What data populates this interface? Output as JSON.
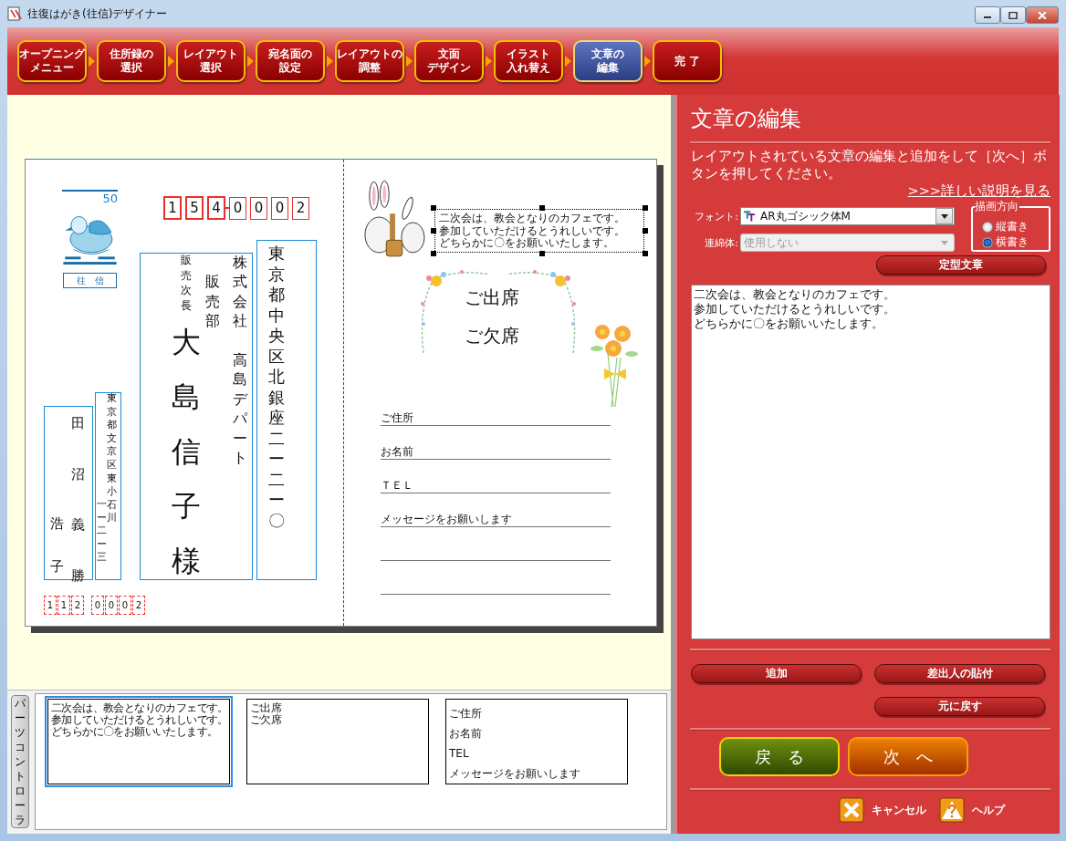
{
  "window": {
    "title": "往復はがき(往信)デザイナー"
  },
  "steps": [
    {
      "label": [
        "オープニング",
        "メニュー"
      ],
      "selected": false
    },
    {
      "label": [
        "住所録の",
        "選択"
      ],
      "selected": false
    },
    {
      "label": [
        "レイアウト",
        "選択"
      ],
      "selected": false
    },
    {
      "label": [
        "宛名面の",
        "設定"
      ],
      "selected": false
    },
    {
      "label": [
        "レイアウトの",
        "調整"
      ],
      "selected": false
    },
    {
      "label": [
        "文面",
        "デザイン"
      ],
      "selected": false
    },
    {
      "label": [
        "イラスト",
        "入れ替え"
      ],
      "selected": false
    },
    {
      "label": [
        "文章の",
        "編集"
      ],
      "selected": true
    },
    {
      "label": [
        "完 了"
      ],
      "selected": false
    }
  ],
  "postcard": {
    "stamp_value": "50",
    "stamp_label": "往　信",
    "postal_code": [
      [
        "1",
        "5",
        "4"
      ],
      [
        "0",
        "0",
        "0",
        "2"
      ]
    ],
    "recipient_address": "東京都中央区北銀座二ー二ー〇",
    "recipient_company": [
      "株式会社",
      "高島デパート"
    ],
    "recipient_department": "販売部",
    "recipient_title": "販売次長",
    "recipient_name": "大島信子様",
    "sender_address": [
      "東京都文京区東小石川",
      "一ー二ー三"
    ],
    "sender_names": [
      "田沼義勝",
      "浩子"
    ],
    "sender_postal_code": [
      [
        "1",
        "1",
        "2"
      ],
      [
        "0",
        "0",
        "0",
        "2"
      ]
    ],
    "selected_text": [
      "二次会は、教会となりのカフェです。",
      "参加していただけるとうれしいです。",
      "どちらかに〇をお願いいたします。"
    ],
    "attendance": [
      "ご出席",
      "ご欠席"
    ],
    "form_fields": [
      "ご住所",
      "お名前",
      "ＴＥＬ",
      "メッセージをお願いします"
    ]
  },
  "parts_controller": {
    "tab_label": "パーツコントローラ",
    "parts": [
      {
        "kind": "text",
        "selected": true,
        "lines": [
          "二次会は、教会となりのカフェです。",
          "参加していただけるとうれしいです。",
          "どちらかに〇をお願いいたします。"
        ]
      },
      {
        "kind": "text",
        "selected": false,
        "lines": [
          "ご出席",
          "ご欠席"
        ]
      },
      {
        "kind": "form",
        "selected": false,
        "lines": [
          "ご住所",
          "お名前",
          "TEL",
          "メッセージをお願いします"
        ]
      }
    ]
  },
  "panel": {
    "title": "文章の編集",
    "description": "レイアウトされている文章の編集と追加をして［次へ］ボタンを押してください。",
    "help_link": ">>>詳しい説明を見る",
    "font": {
      "label": "フォント:",
      "value": "AR丸ゴシック体M"
    },
    "linked_style": {
      "label": "連綿体:",
      "value": "使用しない",
      "disabled": true
    },
    "direction": {
      "label": "描画方向",
      "options": [
        {
          "label": "縦書き",
          "selected": false
        },
        {
          "label": "横書き",
          "selected": true
        }
      ]
    },
    "template_button": "定型文章",
    "text_lines": [
      "二次会は、教会となりのカフェです。",
      "参加していただけるとうれしいです。",
      "どちらかに〇をお願いいたします。"
    ],
    "actions": [
      {
        "label": "追加"
      },
      {
        "label": "差出人の貼付"
      },
      {
        "label": "元に戻す"
      }
    ],
    "navigation": [
      {
        "label": "戻　る",
        "kind": "back"
      },
      {
        "label": "次　へ",
        "kind": "next"
      }
    ],
    "footer": [
      {
        "label": "キャンセル",
        "kind": "cancel"
      },
      {
        "label": "ヘルプ",
        "kind": "help"
      }
    ]
  }
}
